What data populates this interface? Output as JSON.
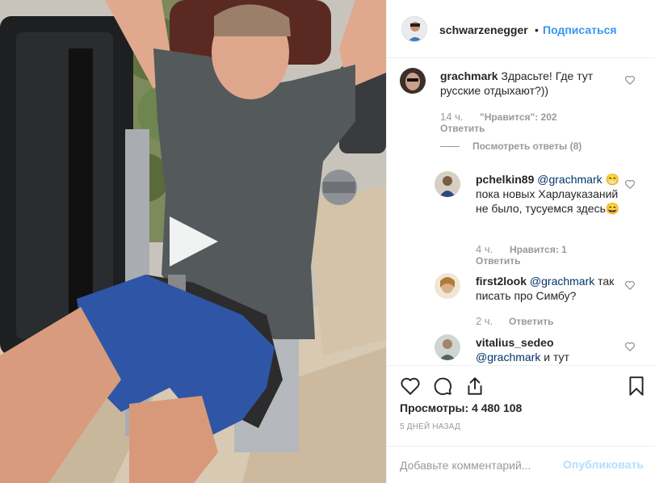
{
  "colors": {
    "link": "#3897f0",
    "mention": "#003569",
    "muted": "#999999",
    "publish_disabled": "#b2dffc"
  },
  "media": {
    "type": "video",
    "play_icon": "play-icon"
  },
  "header": {
    "username": "schwarzenegger",
    "separator": "•",
    "follow_label": "Подписаться"
  },
  "comments": [
    {
      "username": "grachmark",
      "text": "Здрасьте! Где тут русские отдыхают?))",
      "time": "14 ч.",
      "likes": "\"Нравится\": 202",
      "reply": "Ответить",
      "view_replies": "Посмотреть ответы (8)"
    },
    {
      "username": "pchelkin89",
      "mention": "@grachmark",
      "text": "😁пока новых Харлауказаний не было, тусуемся здесь😄",
      "time": "4 ч.",
      "likes": "Нравится: 1",
      "reply": "Ответить"
    },
    {
      "username": "first2look",
      "mention": "@grachmark",
      "text": "так писать про Симбу?",
      "time": "2 ч.",
      "reply": "Ответить"
    },
    {
      "username": "vitalius_sedeo",
      "mention": "@grachmark",
      "text": "и тут"
    }
  ],
  "actions": {
    "like_icon": "heart-icon",
    "comment_icon": "comment-icon",
    "share_icon": "share-icon",
    "save_icon": "bookmark-icon",
    "views_label": "Просмотры:",
    "views_count": "4 480 108",
    "date": "5 ДНЕЙ НАЗАД"
  },
  "comment_form": {
    "placeholder": "Добавьте комментарий...",
    "publish_label": "Опубликовать"
  }
}
